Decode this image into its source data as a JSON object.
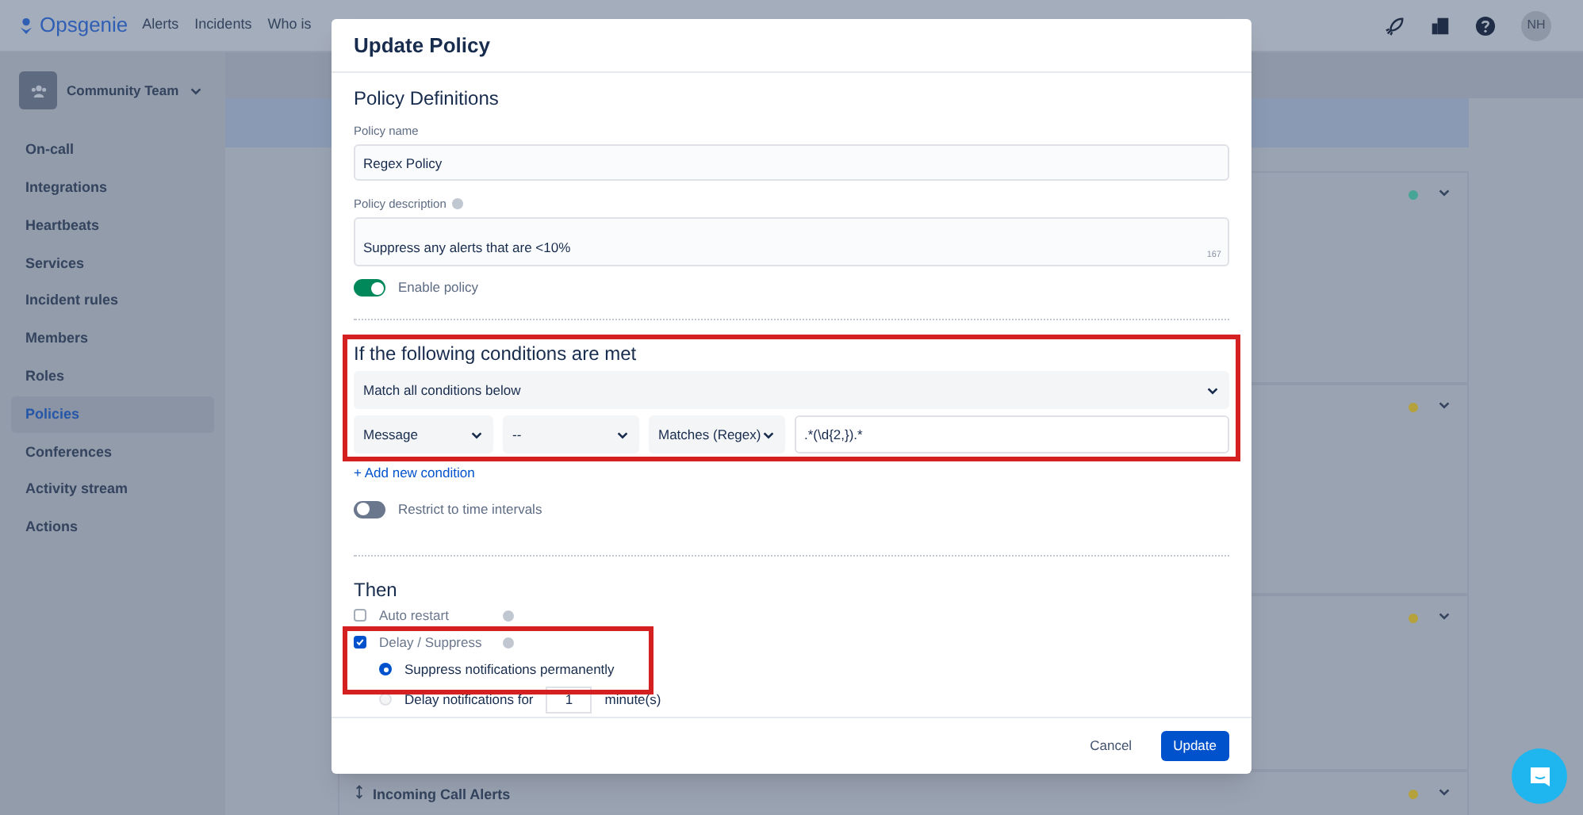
{
  "topbar": {
    "logo": "Opsgenie",
    "nav": [
      "Alerts",
      "Incidents",
      "Who is"
    ],
    "avatar": "NH"
  },
  "sidebar": {
    "team": "Community Team",
    "items": [
      {
        "label": "On-call",
        "selected": false
      },
      {
        "label": "Integrations",
        "selected": false
      },
      {
        "label": "Heartbeats",
        "selected": false
      },
      {
        "label": "Services",
        "selected": false
      },
      {
        "label": "Incident rules",
        "selected": false
      },
      {
        "label": "Members",
        "selected": false
      },
      {
        "label": "Roles",
        "selected": false
      },
      {
        "label": "Policies",
        "selected": true
      },
      {
        "label": "Conferences",
        "selected": false
      },
      {
        "label": "Activity stream",
        "selected": false
      },
      {
        "label": "Actions",
        "selected": false
      }
    ]
  },
  "policy_rows": [
    {
      "color": "#46a594"
    },
    {
      "color": "#b5a23c"
    },
    {
      "color": "#b5a23c"
    },
    {
      "title": "Incoming Call Alerts",
      "color": "#b5a23c"
    }
  ],
  "dialog": {
    "title": "Update Policy",
    "definitions": {
      "heading": "Policy Definitions",
      "name_label": "Policy name",
      "name_value": "Regex Policy",
      "description_label": "Policy description",
      "description_value": "Suppress any alerts that are <10%",
      "description_counter": "167",
      "enable": {
        "label": "Enable policy",
        "on": true
      }
    },
    "conditions": {
      "highlighted": true,
      "heading": "If the following conditions are met",
      "match": "Match all conditions below",
      "rows": [
        {
          "field": "Message",
          "negation": "--",
          "operator": "Matches (Regex)",
          "value": ".*(\\d{2,}).*"
        }
      ],
      "add_link": "+ Add new condition",
      "restrict": {
        "label": "Restrict to time intervals",
        "on": false
      }
    },
    "then": {
      "heading": "Then",
      "auto_restart": {
        "label": "Auto restart",
        "checked": false
      },
      "delay_suppress": {
        "label": "Delay / Suppress",
        "checked": true,
        "highlighted": true,
        "options": [
          {
            "kind": "plain",
            "label": "Suppress notifications permanently",
            "selected": true
          },
          {
            "kind": "delay",
            "label": "Delay notifications for",
            "value": "1",
            "unit": "minute(s)",
            "selected": false
          }
        ]
      }
    },
    "buttons": {
      "cancel": "Cancel",
      "update": "Update"
    }
  }
}
